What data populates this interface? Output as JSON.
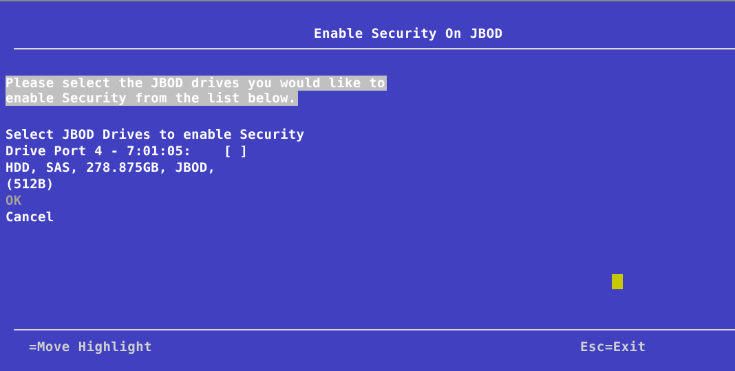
{
  "header": {
    "title": "Enable Security On JBOD"
  },
  "help_text": {
    "line1": "Please select the JBOD drives you would like to",
    "line2": "enable Security from the list below."
  },
  "form": {
    "section_title": "Select JBOD Drives to enable Security",
    "drive": {
      "label": "Drive Port 4 - 7:01:05:",
      "checkbox": "[ ]",
      "details": "HDD, SAS, 278.875GB, JBOD,",
      "block_size": "(512B)"
    },
    "ok_label": "OK",
    "cancel_label": "Cancel"
  },
  "footer": {
    "left_hint": "=Move Highlight",
    "right_hint": "Esc=Exit"
  },
  "colors": {
    "background": "#4040c0",
    "text": "#ffffff",
    "help_highlight": "#c0c0c0",
    "disabled": "#a0a0a0",
    "cursor": "#c8c800"
  }
}
